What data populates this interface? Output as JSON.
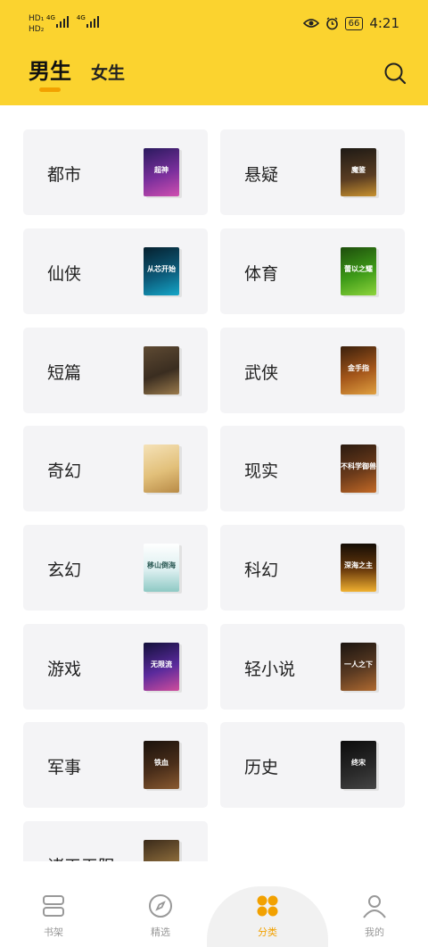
{
  "status_bar": {
    "left_hd_1": "HD₁",
    "left_hd_2": "HD₂",
    "net_1": "4G",
    "net_2": "4G",
    "battery": "66",
    "time": "4:21"
  },
  "header": {
    "tabs": [
      {
        "label": "男生",
        "active": true
      },
      {
        "label": "女生",
        "active": false
      }
    ],
    "accent_color": "#FBD32F"
  },
  "categories": [
    {
      "label": "都市",
      "cover_text": "超神"
    },
    {
      "label": "悬疑",
      "cover_text": "魔鉴"
    },
    {
      "label": "仙侠",
      "cover_text": "从芯开始"
    },
    {
      "label": "体育",
      "cover_text": "蕾以之耀"
    },
    {
      "label": "短篇",
      "cover_text": ""
    },
    {
      "label": "武侠",
      "cover_text": "金手指"
    },
    {
      "label": "奇幻",
      "cover_text": ""
    },
    {
      "label": "现实",
      "cover_text": "不科学御兽"
    },
    {
      "label": "玄幻",
      "cover_text": "移山倒海"
    },
    {
      "label": "科幻",
      "cover_text": "深海之主"
    },
    {
      "label": "游戏",
      "cover_text": "无限流"
    },
    {
      "label": "轻小说",
      "cover_text": "一人之下"
    },
    {
      "label": "军事",
      "cover_text": "铁血"
    },
    {
      "label": "历史",
      "cover_text": "终宋"
    },
    {
      "label": "诸天无限",
      "cover_text": ""
    }
  ],
  "bottom_nav": [
    {
      "label": "书架",
      "icon": "bookshelf-icon",
      "active": false
    },
    {
      "label": "精选",
      "icon": "compass-icon",
      "active": false
    },
    {
      "label": "分类",
      "icon": "category-grid-icon",
      "active": true
    },
    {
      "label": "我的",
      "icon": "user-icon",
      "active": false
    }
  ]
}
